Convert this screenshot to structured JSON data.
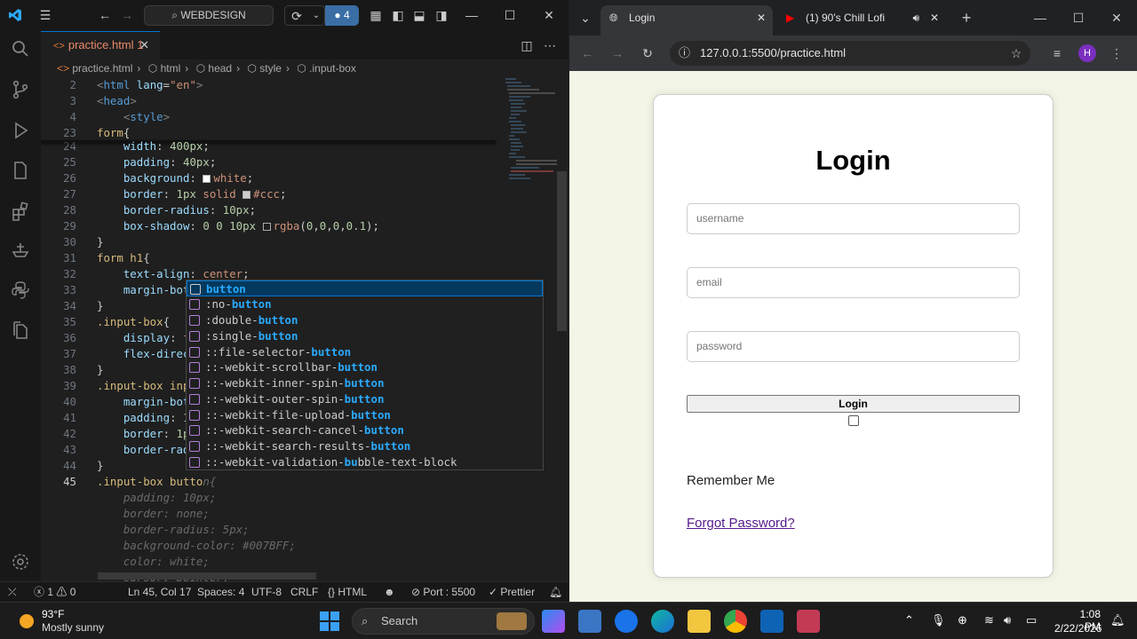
{
  "vscode": {
    "search_label": "WEBDESIGN",
    "badge_count": "4",
    "tab_label": "practice.html",
    "tab_problems": "1",
    "breadcrumb": [
      "practice.html",
      "html",
      "head",
      "style",
      ".input-box"
    ],
    "lines": [
      {
        "n": "2"
      },
      {
        "n": "3"
      },
      {
        "n": "4"
      },
      {
        "n": "23"
      },
      {
        "n": "24"
      },
      {
        "n": "25"
      },
      {
        "n": "26"
      },
      {
        "n": "27"
      },
      {
        "n": "28"
      },
      {
        "n": "29"
      },
      {
        "n": "30"
      },
      {
        "n": "31"
      },
      {
        "n": "32"
      },
      {
        "n": "33"
      },
      {
        "n": "34"
      },
      {
        "n": "35"
      },
      {
        "n": "36"
      },
      {
        "n": "37"
      },
      {
        "n": "38"
      },
      {
        "n": "39"
      },
      {
        "n": "40"
      },
      {
        "n": "41"
      },
      {
        "n": "42"
      },
      {
        "n": "43"
      },
      {
        "n": "44"
      },
      {
        "n": "45"
      }
    ],
    "suggestions": [
      "button",
      ":no-button",
      ":double-button",
      ":single-button",
      "::file-selector-button",
      "::-webkit-scrollbar-button",
      "::-webkit-inner-spin-button",
      "::-webkit-outer-spin-button",
      "::-webkit-file-upload-button",
      "::-webkit-search-cancel-button",
      "::-webkit-search-results-button",
      "::-webkit-validation-bubble-text-block"
    ],
    "status": {
      "errors": "1",
      "warnings": "0",
      "position": "Ln 45, Col 17",
      "spaces": "Spaces: 4",
      "encoding": "UTF-8",
      "eol": "CRLF",
      "language": "HTML",
      "port": "Port : 5500",
      "formatter": "Prettier"
    }
  },
  "browser": {
    "tab1_title": "Login",
    "tab2_title": "(1) 90's Chill Lofi",
    "url": "127.0.0.1:5500/practice.html",
    "profile_initial": "H",
    "page": {
      "title": "Login",
      "username_placeholder": "username",
      "email_placeholder": "email",
      "password_placeholder": "password",
      "button_label": "Login",
      "remember_label": "Remember Me",
      "forgot_link": "Forgot Password?"
    }
  },
  "taskbar": {
    "weather_temp": "93°F",
    "weather_desc": "Mostly sunny",
    "search_placeholder": "Search",
    "time": "1:08 PM",
    "date": "2/22/2026"
  },
  "colors": {
    "vscode_bg": "#1f1f1f",
    "accent": "#0078d4",
    "page_bg": "#f3f6e6",
    "link": "#551a8b"
  }
}
